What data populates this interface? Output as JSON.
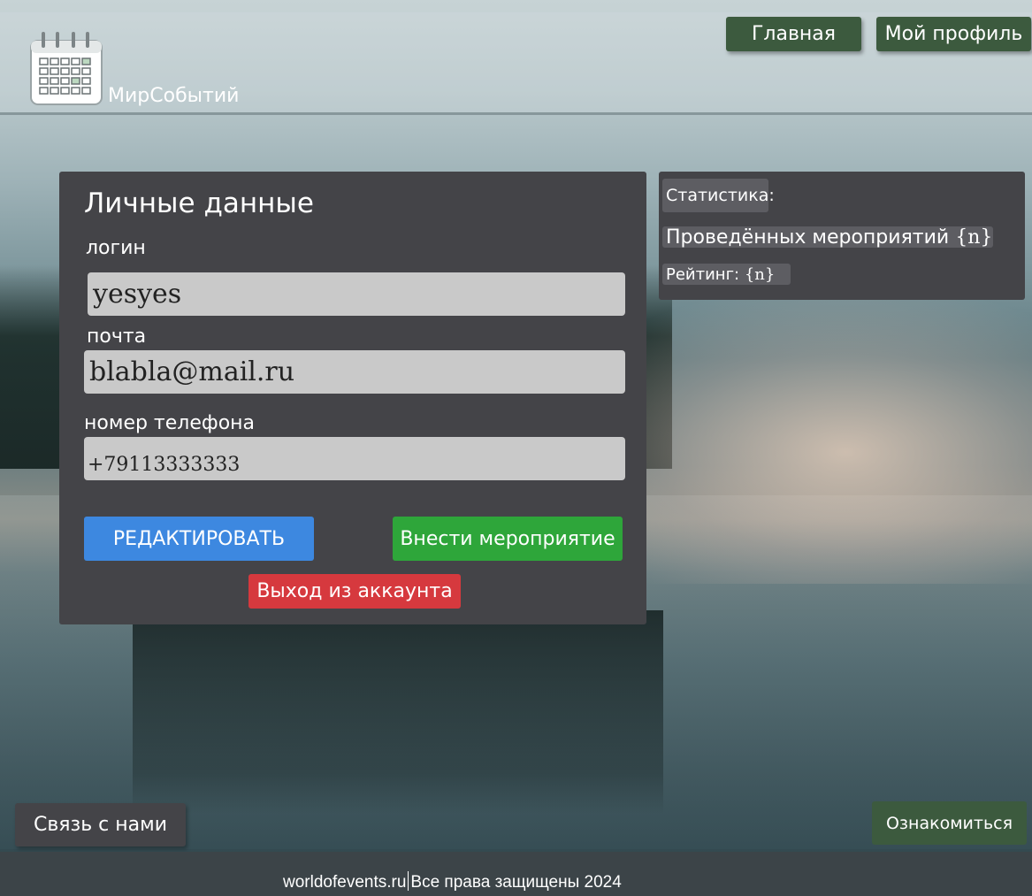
{
  "brand": {
    "name": "МирСобытий",
    "logo_icon": "calendar-icon"
  },
  "nav": {
    "home": "Главная",
    "profile": "Мой профиль"
  },
  "personal": {
    "title": "Личные данные",
    "login_label": "логин",
    "login_value": "yesyes",
    "email_label": "почта",
    "email_value": "blabla@mail.ru",
    "phone_label": "номер телефона",
    "phone_value": "+79113333333",
    "edit_button": "РЕДАКТИРОВАТЬ",
    "add_event_button": "Внести мероприятие",
    "logout_button": "Выход из аккаунта"
  },
  "stats": {
    "title": "Статистика:",
    "events_label": "Проведённых мероприятий",
    "events_value": "{n}",
    "rating_label": "Рейтинг:",
    "rating_value": "{n}"
  },
  "bottom": {
    "contact": "Связь с нами",
    "learn_more": "Ознакомиться"
  },
  "footer": {
    "site": "worldofevents.ru",
    "rights": "Все права защищены 2024"
  },
  "colors": {
    "panel": "#444448",
    "nav_green": "#3c5a3e",
    "edit_blue": "#3d88e0",
    "add_green": "#2ea63a",
    "logout_red": "#d6393e"
  }
}
